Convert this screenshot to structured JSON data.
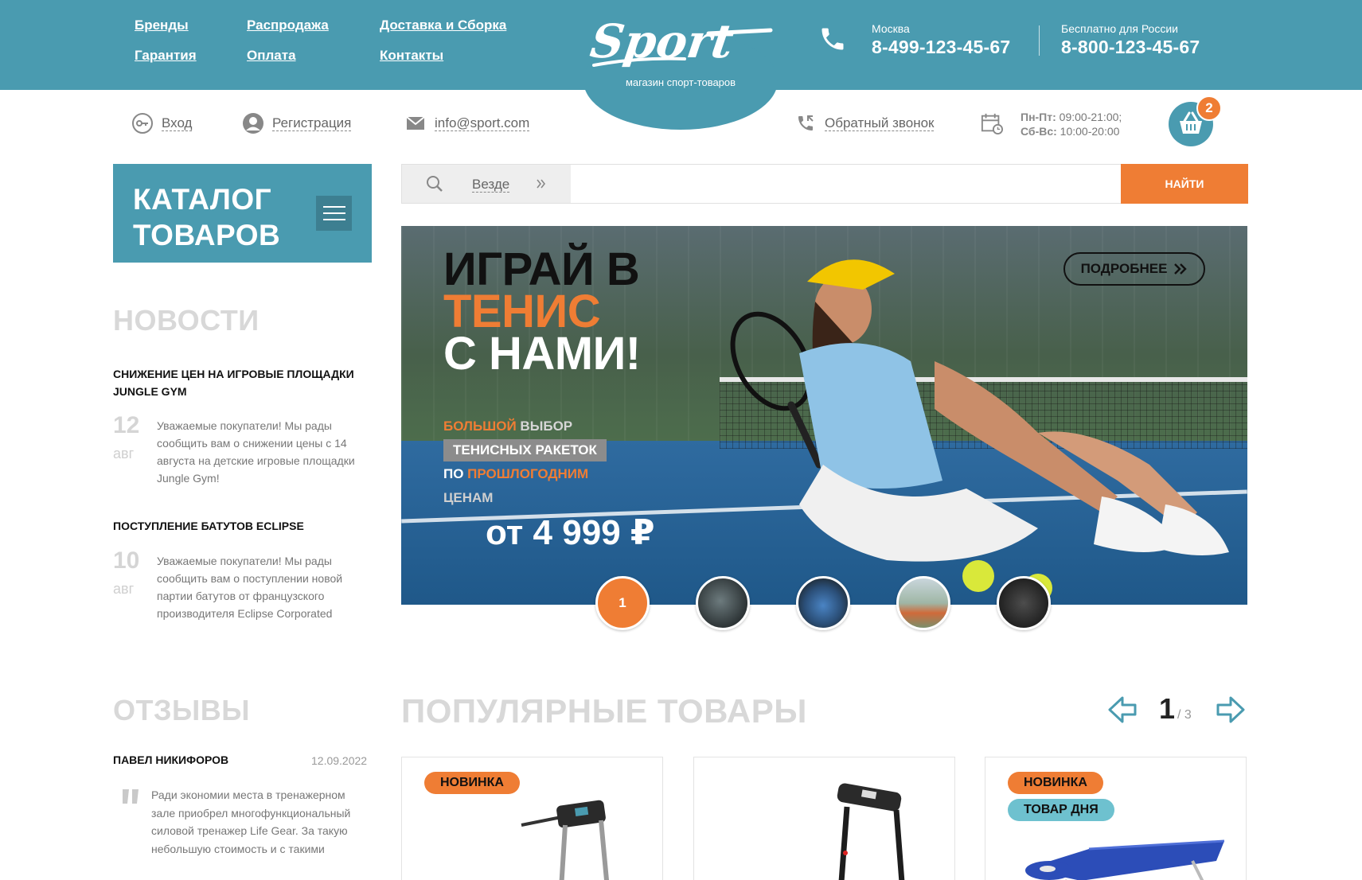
{
  "header": {
    "nav": [
      "Бренды",
      "Распродажа",
      "Доставка и Сборка",
      "Гарантия",
      "Оплата",
      "Контакты"
    ],
    "logo_text": "Sport",
    "logo_tagline": "магазин спорт-товаров",
    "phones": [
      {
        "city": "Москва",
        "number": "8-499-123-45-67"
      },
      {
        "city": "Бесплатно для России",
        "number": "8-800-123-45-67"
      }
    ]
  },
  "subheader": {
    "login": "Вход",
    "register": "Регистрация",
    "email": "info@sport.com",
    "callback": "Обратный звонок",
    "hours_weekday_label": "Пн-Пт:",
    "hours_weekday": " 09:00-21:00;",
    "hours_weekend_label": "Сб-Вс:",
    "hours_weekend": " 10:00-20:00",
    "cart_count": "2"
  },
  "catalog": {
    "title": "КАТАЛОГ\nТОВАРОВ"
  },
  "search": {
    "scope": "Везде",
    "placeholder": "",
    "button": "НАЙТИ"
  },
  "news": {
    "title": "НОВОСТИ",
    "items": [
      {
        "title": "СНИЖЕНИЕ ЦЕН НА ИГРОВЫЕ ПЛОЩАДКИ JUNGLE GYM",
        "day": "12",
        "month": "авг",
        "text": "Уважаемые покупатели! Мы рады сообщить вам о снижении цены с 14 августа на детские игровые площадки Jungle Gym!"
      },
      {
        "title": "ПОСТУПЛЕНИЕ БАТУТОВ ECLIPSE",
        "day": "10",
        "month": "авг",
        "text": "Уважаемые покупатели! Мы рады сообщить вам о поступлении новой партии батутов от французского производителя Eclipse Corporated"
      }
    ]
  },
  "banner": {
    "line1": "ИГРАЙ В",
    "line2": "ТЕНИС",
    "line3": "С НАМИ!",
    "sub1_accent": "БОЛЬШОЙ",
    "sub1_rest": " ВЫБОР",
    "sub2": "ТЕНИСНЫХ РАКЕТОК",
    "sub3_prefix": "ПО ",
    "sub3_accent": "ПРОШЛОГОДНИМ",
    "sub4": "ЦЕНАМ",
    "price": "от 4 999 ₽",
    "more_button": "ПОДРОБНЕЕ",
    "active_slide": "1"
  },
  "reviews": {
    "title": "ОТЗЫВЫ",
    "author": "ПАВЕЛ НИКИФОРОВ",
    "date": "12.09.2022",
    "text": "Ради экономии места в тренажерном зале приобрел многофункциональный силовой тренажер Life Gear. За такую небольшую стоимость и с такими"
  },
  "popular": {
    "title": "ПОПУЛЯРНЫЕ ТОВАРЫ",
    "page_current": "1",
    "page_total": "/ 3",
    "badges": {
      "new": "НОВИНКА",
      "day": "ТОВАР ДНЯ"
    }
  },
  "colors": {
    "teal": "#4a9bb0",
    "orange": "#ef7d34",
    "light_teal": "#6ec1cf"
  }
}
